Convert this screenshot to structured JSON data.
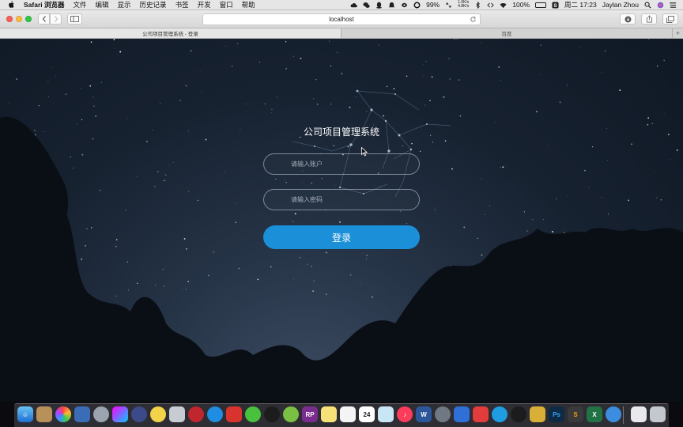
{
  "menubar": {
    "app_name": "Safari 浏览器",
    "menus": [
      "文件",
      "编辑",
      "显示",
      "历史记录",
      "书签",
      "开发",
      "窗口",
      "帮助"
    ],
    "battery_level_label": "99%",
    "net_up": "1.0K/s",
    "net_down": "4.8K/s",
    "battery_percent": "100%",
    "clock": "周二 17:23",
    "user": "Jaylan Zhou"
  },
  "toolbar": {
    "url": "localhost"
  },
  "tabs": [
    {
      "label": "公司项目管理系统 - 登录",
      "active": true
    },
    {
      "label": "百度",
      "active": false
    }
  ],
  "login": {
    "title": "公司项目管理系统",
    "username_placeholder": "请输入账户",
    "password_placeholder": "请输入密码",
    "submit_label": "登录"
  },
  "dock": {
    "badge_24": "24",
    "rp_label": "RP",
    "ps_label": "Ps",
    "excel_label": "X"
  },
  "colors": {
    "login_button": "#1b8fd8",
    "background": "#172231"
  }
}
